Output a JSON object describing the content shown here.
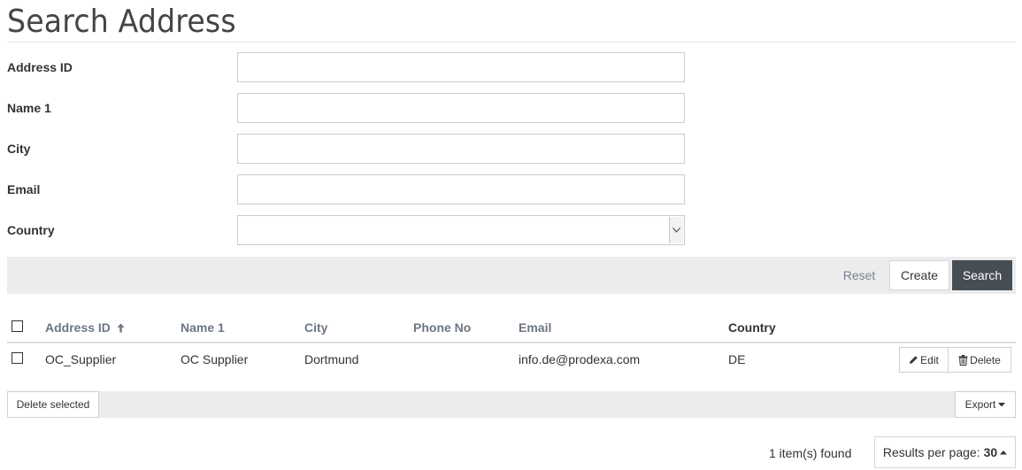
{
  "page": {
    "title": "Search Address"
  },
  "form": {
    "fields": [
      {
        "label": "Address ID",
        "value": ""
      },
      {
        "label": "Name 1",
        "value": ""
      },
      {
        "label": "City",
        "value": ""
      },
      {
        "label": "Email",
        "value": ""
      }
    ],
    "country": {
      "label": "Country",
      "value": ""
    }
  },
  "actions": {
    "reset": "Reset",
    "create": "Create",
    "search": "Search"
  },
  "table": {
    "columns": [
      "Address ID",
      "Name 1",
      "City",
      "Phone No",
      "Email",
      "Country"
    ],
    "sort_column": "Address ID",
    "sort_icon": "arrow-up-icon",
    "rows": [
      {
        "address_id": "OC_Supplier",
        "name1": "OC Supplier",
        "city": "Dortmund",
        "phone": "",
        "email": "info.de@prodexa.com",
        "country": "DE"
      }
    ],
    "row_actions": {
      "edit": "Edit",
      "delete": "Delete"
    }
  },
  "footer": {
    "delete_selected": "Delete selected",
    "export": "Export",
    "items_found": "1 item(s) found",
    "per_page_label": "Results per page:",
    "per_page_value": "30"
  }
}
